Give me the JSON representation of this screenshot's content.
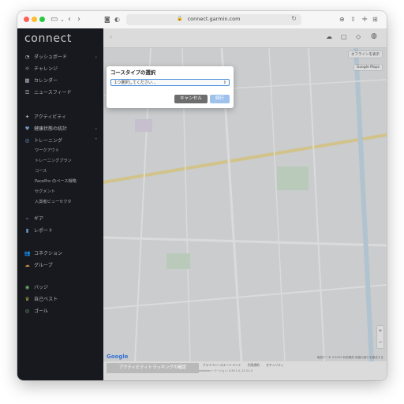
{
  "browser": {
    "url": "connect.garmin.com"
  },
  "sidebar": {
    "logo": "connect",
    "items": [
      {
        "label": "ダッシュボード",
        "icon": "dashboard-icon"
      },
      {
        "label": "チャレンジ",
        "icon": "trophy-icon"
      },
      {
        "label": "カレンダー",
        "icon": "calendar-icon"
      },
      {
        "label": "ニュースフィード",
        "icon": "newsfeed-icon"
      },
      {
        "label": "アクティビティ",
        "icon": "runner-icon"
      },
      {
        "label": "健康状態の統計",
        "icon": "heart-icon"
      },
      {
        "label": "トレーニング",
        "icon": "training-icon"
      }
    ],
    "training_sub": [
      "ワークアウト",
      "トレーニングプラン",
      "コース",
      "PacePro のペース戦略",
      "セグメント",
      "入賞者ビューセクタ"
    ],
    "items2": [
      {
        "label": "ギア",
        "icon": "shoe-icon"
      },
      {
        "label": "レポート",
        "icon": "chart-icon"
      },
      {
        "label": "コネクション",
        "icon": "connections-icon"
      },
      {
        "label": "グループ",
        "icon": "group-icon"
      },
      {
        "label": "バッジ",
        "icon": "badge-icon"
      },
      {
        "label": "自己ベスト",
        "icon": "record-icon"
      },
      {
        "label": "ゴール",
        "icon": "goal-icon"
      }
    ]
  },
  "map": {
    "labels": {
      "offline": "オフラインを表示",
      "google_maps": "Google Maps",
      "google": "Google",
      "attribution": "地図データ ©2022  利用規約  地図の誤りを報告する"
    }
  },
  "footer": {
    "links": [
      "ヘルプ",
      "ステータス",
      "Facebook",
      "Instagram",
      "Twitter",
      "プライバシーステートメント",
      "利用規約",
      "セキュリティ"
    ],
    "copyright": "Connect 965   Garmin • Copyright © 1996-2022 Garmin Ltd. or its subsidiaries • バージョン: 4.59.1.0, 22.3.1.0",
    "track_button": "アクティビティトラッキングの確認"
  },
  "modal": {
    "title": "コースタイプの選択",
    "select_value": "1つ選択してください...",
    "cancel_label": "キャンセル",
    "next_label": "続行"
  },
  "colors": {
    "sidebar_bg": "#1b1e24",
    "cancel_bg": "#6d6d6d",
    "next_bg": "#9ec2ec",
    "select_border": "#4a90d9"
  }
}
